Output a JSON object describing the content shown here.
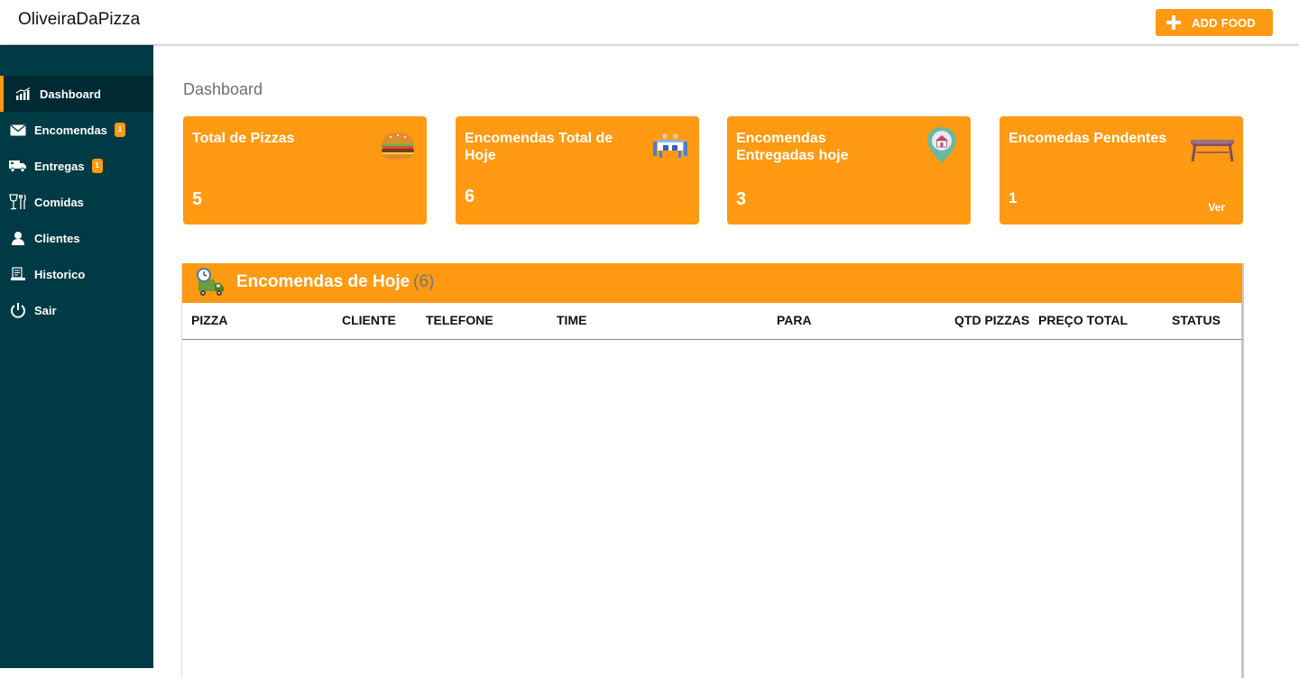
{
  "header": {
    "brand": "OliveiraDaPizza",
    "add_food_label": "ADD FOOD"
  },
  "sidebar": {
    "items": [
      {
        "label": "Dashboard",
        "icon": "chart-bars-icon",
        "active": true
      },
      {
        "label": "Encomendas",
        "icon": "envelope-icon",
        "badge": "1"
      },
      {
        "label": "Entregas",
        "icon": "truck-icon",
        "badge": "1"
      },
      {
        "label": "Comidas",
        "icon": "glass-cutlery-icon"
      },
      {
        "label": "Clientes",
        "icon": "user-icon"
      },
      {
        "label": "Historico",
        "icon": "history-icon"
      },
      {
        "label": "Sair",
        "icon": "power-icon"
      }
    ]
  },
  "main": {
    "title": "Dashboard",
    "cards": [
      {
        "title": "Total de Pizzas",
        "value": "5",
        "icon": "burger-icon"
      },
      {
        "title": "Encomendas Total de Hoje",
        "value": "6",
        "icon": "dining-table-icon"
      },
      {
        "title": "Encomendas Entregadas hoje",
        "value": "3",
        "icon": "location-pin-icon"
      },
      {
        "title": "Encomedas Pendentes",
        "value": "1",
        "icon": "bench-icon",
        "link": "Ver"
      }
    ],
    "orders": {
      "title": "Encomendas de Hoje",
      "count": "(6)",
      "icon": "delivery-truck-clock-icon",
      "columns": [
        "PIZZA",
        "CLIENTE",
        "TELEFONE",
        "TIME",
        "PARA",
        "QTD PIZZAS",
        "PREÇO TOTAL",
        "STATUS"
      ]
    }
  },
  "colors": {
    "accent": "#ff9a12",
    "sidebar": "#003a44",
    "sidebar_active": "#002a32"
  }
}
